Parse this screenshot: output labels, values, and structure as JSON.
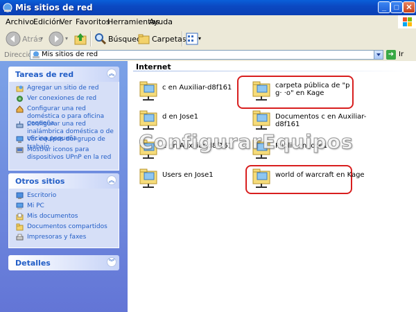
{
  "window": {
    "title": "Mis sitios de red"
  },
  "menu": [
    "Archivo",
    "Edición",
    "Ver",
    "Favoritos",
    "Herramientas",
    "Ayuda"
  ],
  "toolbar": {
    "back": "Atrás",
    "search": "Búsqueda",
    "folders": "Carpetas"
  },
  "address": {
    "label": "Dirección",
    "value": "Mis sitios de red",
    "go": "Ir"
  },
  "tasks_panel": {
    "title": "Tareas de red",
    "items": [
      "Agregar un sitio de red",
      "Ver conexiones de red",
      "Configurar una red doméstica o para oficina pequeña",
      "Configurar una red inalámbrica doméstica o de oficina pequeña",
      "Ver equipos del grupo de trabajo",
      "Mostrar iconos para dispositivos UPnP en la red"
    ]
  },
  "places_panel": {
    "title": "Otros sitios",
    "items": [
      "Escritorio",
      "Mi PC",
      "Mis documentos",
      "Documentos compartidos",
      "Impresoras y faxes"
    ]
  },
  "details_panel": {
    "title": "Detalles"
  },
  "content": {
    "group_header": "Internet",
    "shares": [
      {
        "name": "c en Auxiliar-d8f161"
      },
      {
        "name": "carpeta pública de \"p g· ·o\" en Kage"
      },
      {
        "name": "d en Jose1"
      },
      {
        "name": "Documentos c en Auxiliar-d8f161"
      },
      {
        "name": "e en Auxiliar-d8f161"
      },
      {
        "name": "Public en Jose1"
      },
      {
        "name": "Users en Jose1"
      },
      {
        "name": "world of warcraft en Kage"
      }
    ]
  },
  "watermark": "ConfigurarEquipos",
  "colors": {
    "titlebar": "#0b49c2",
    "link": "#215dc6",
    "highlight_box": "#d81e1e",
    "pane_bg": "#7ba2e7"
  }
}
